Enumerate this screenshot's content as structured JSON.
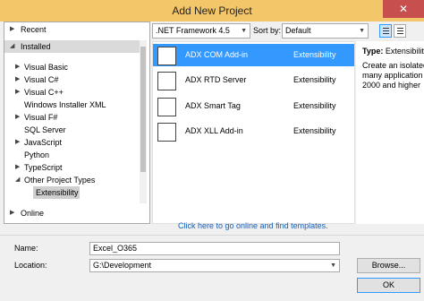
{
  "window": {
    "title": "Add New Project",
    "close_glyph": "✕"
  },
  "tree": {
    "recent": "Recent",
    "installed": "Installed",
    "items": [
      "Visual Basic",
      "Visual C#",
      "Visual C++",
      "Windows Installer XML",
      "Visual F#",
      "SQL Server",
      "JavaScript",
      "Python",
      "TypeScript",
      "Other Project Types",
      "Extensibility"
    ],
    "online": "Online"
  },
  "toolbar": {
    "framework": ".NET Framework 4.5",
    "sort_label": "Sort by:",
    "sort_value": "Default"
  },
  "templates": [
    {
      "name": "ADX COM Add-in",
      "category": "Extensibility",
      "selected": true
    },
    {
      "name": "ADX RTD Server",
      "category": "Extensibility",
      "selected": false
    },
    {
      "name": "ADX Smart Tag",
      "category": "Extensibility",
      "selected": false
    },
    {
      "name": "ADX XLL Add-in",
      "category": "Extensibility",
      "selected": false
    }
  ],
  "description": {
    "type_label": "Type:",
    "type_value": "Extensibility",
    "lines": [
      "Create an isolated",
      "many application",
      "2000 and higher"
    ]
  },
  "online_link": "Click here to go online and find templates.",
  "form": {
    "name_label": "Name:",
    "name_value": "Excel_O365",
    "location_label": "Location:",
    "location_value": "G:\\Development",
    "browse_label": "Browse...",
    "ok_label": "OK"
  },
  "colors": {
    "titlebar": "#f4c66a",
    "selection": "#3399ff",
    "close": "#c7504f",
    "link": "#1a5fb4"
  }
}
